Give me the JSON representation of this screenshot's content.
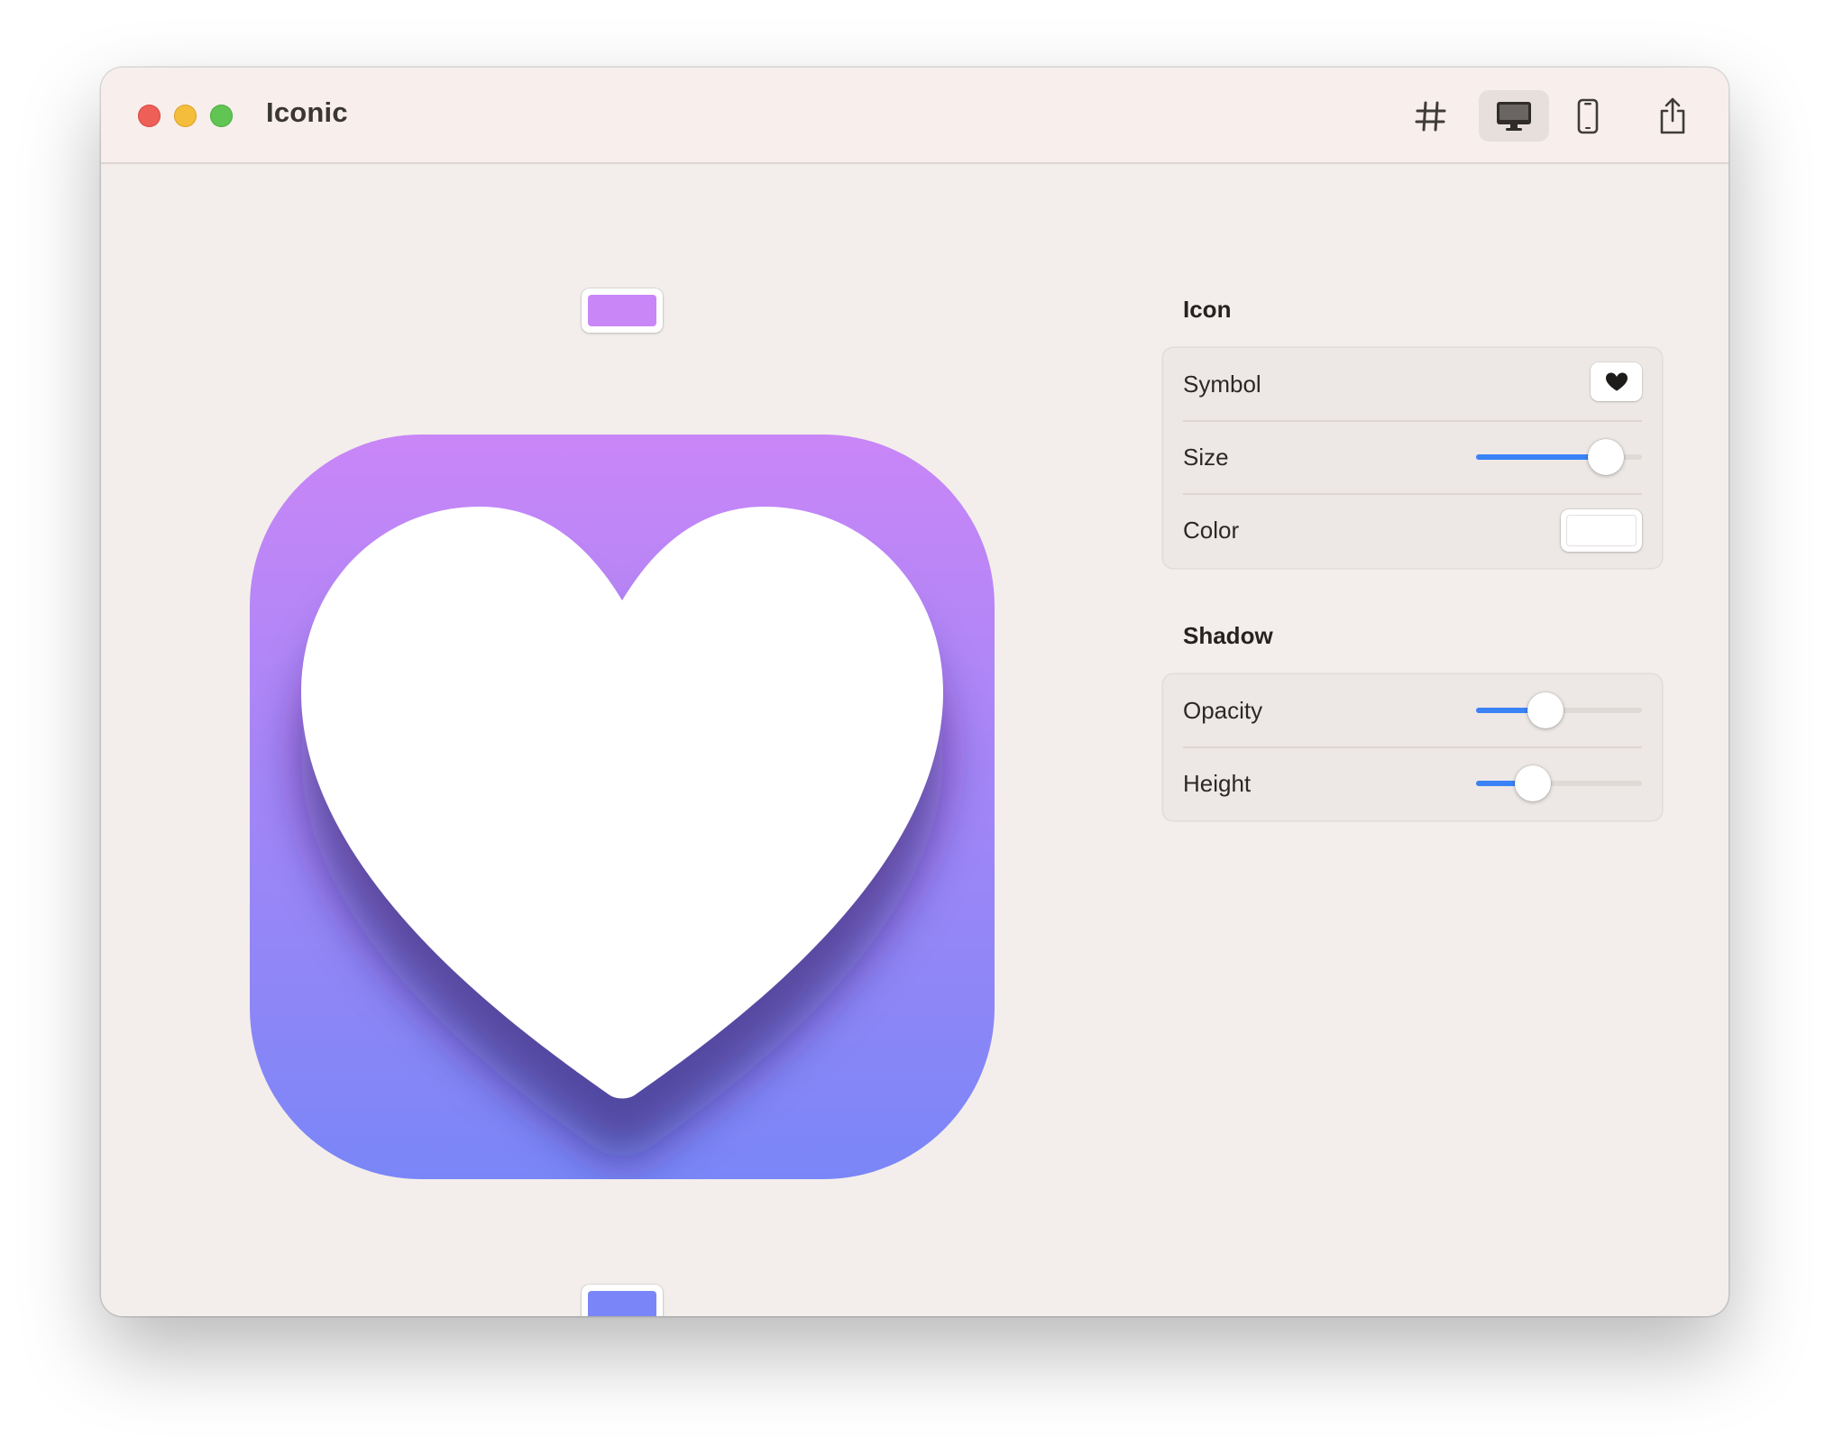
{
  "app": {
    "title": "Iconic"
  },
  "toolbar": {
    "buttons": [
      {
        "name": "grid-toggle",
        "icon": "grid-icon",
        "active": false
      },
      {
        "name": "desktop-preview",
        "icon": "desktop-icon",
        "active": true
      },
      {
        "name": "phone-preview",
        "icon": "phone-icon",
        "active": false
      },
      {
        "name": "share",
        "icon": "share-icon",
        "active": false
      }
    ]
  },
  "canvas": {
    "gradient_top_color": "#c986f7",
    "gradient_bottom_color": "#7a86f7",
    "symbol": "heart-icon",
    "symbol_color": "#ffffff"
  },
  "inspector": {
    "icon_section": {
      "title": "Icon",
      "symbol_label": "Symbol",
      "symbol_value": "heart-icon",
      "size_label": "Size",
      "size_value": 0.78,
      "color_label": "Color",
      "color_value": "#ffffff"
    },
    "shadow_section": {
      "title": "Shadow",
      "opacity_label": "Opacity",
      "opacity_value": 0.42,
      "height_label": "Height",
      "height_value": 0.34
    }
  },
  "colors": {
    "accent": "#3a82f6",
    "window_background": "#f3eeeb",
    "titlebar_background": "#f8efec"
  }
}
